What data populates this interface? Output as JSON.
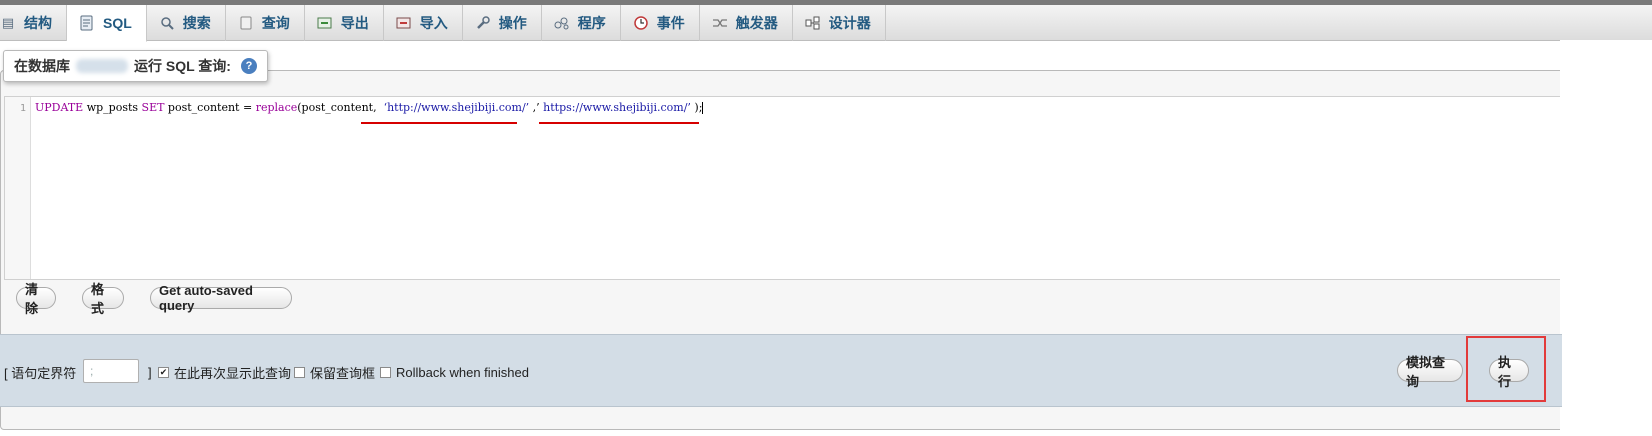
{
  "tabs": [
    {
      "label": "结构",
      "icon": "table-structure-icon"
    },
    {
      "label": "SQL",
      "icon": "sql-document-icon",
      "active": true
    },
    {
      "label": "搜索",
      "icon": "search-icon"
    },
    {
      "label": "查询",
      "icon": "query-icon"
    },
    {
      "label": "导出",
      "icon": "export-icon"
    },
    {
      "label": "导入",
      "icon": "import-icon"
    },
    {
      "label": "操作",
      "icon": "wrench-icon"
    },
    {
      "label": "程序",
      "icon": "routines-icon"
    },
    {
      "label": "事件",
      "icon": "clock-icon"
    },
    {
      "label": "触发器",
      "icon": "trigger-icon"
    },
    {
      "label": "设计器",
      "icon": "designer-icon"
    }
  ],
  "legend": {
    "prefix": "在数据库",
    "suffix": "运行 SQL 查询:",
    "help_icon": "help-icon"
  },
  "editor": {
    "line_number": "1",
    "query": {
      "kw_update": "UPDATE",
      "table": " wp_posts ",
      "kw_set": "SET",
      "assign": " post_content = ",
      "fn_replace": "replace",
      "args_open": "(post_content,  ",
      "old_url": "‘http://www.shejibiji.com/’",
      "sep": " ,’ ",
      "new_url": "https://www.shejibiji.com/’",
      "close": " );"
    }
  },
  "buttons": {
    "clear": "清除",
    "format": "格式",
    "get_autosaved": "Get auto-saved query",
    "simulate": "模拟查询",
    "execute": "执行"
  },
  "options": {
    "delimiter_label": "[ 语句定界符",
    "delimiter_value": ";",
    "bracket_close": "]",
    "show_again": {
      "label": "在此再次显示此查询",
      "checked": true
    },
    "retain_box": {
      "label": "保留查询框",
      "checked": false
    },
    "rollback": {
      "label": "Rollback when finished",
      "checked": false
    }
  },
  "colors": {
    "annotation_red": "#e23a3a",
    "tab_text": "#235a81",
    "keyword": "#990099",
    "url_text": "#1a1aa6"
  }
}
